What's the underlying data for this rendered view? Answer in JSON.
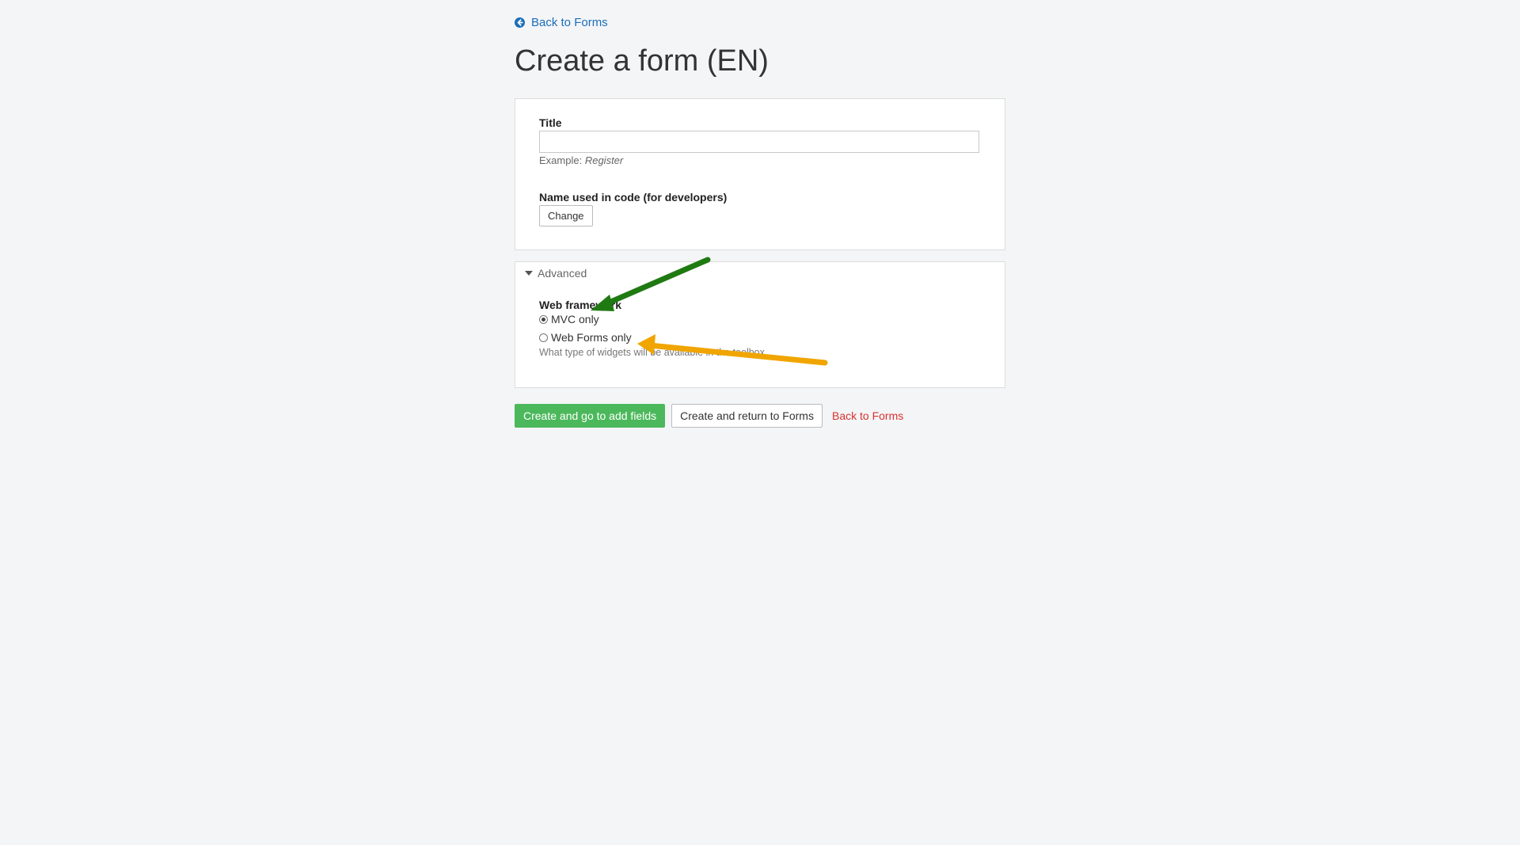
{
  "nav": {
    "back_label": "Back to Forms"
  },
  "page": {
    "title": "Create a form (EN)"
  },
  "form": {
    "title_label": "Title",
    "title_value": "",
    "example_prefix": "Example:",
    "example_value": "Register",
    "code_name_label": "Name used in code (for developers)",
    "change_button": "Change"
  },
  "advanced": {
    "toggle_label": "Advanced",
    "framework_label": "Web framework",
    "options": [
      {
        "label": "MVC only",
        "checked": true
      },
      {
        "label": "Web Forms only",
        "checked": false
      }
    ],
    "help_text": "What type of widgets will be available in the toolbox"
  },
  "actions": {
    "create_add_fields": "Create and go to add fields",
    "create_return": "Create and return to Forms",
    "back_to_forms": "Back to Forms"
  },
  "colors": {
    "link": "#1a6fb9",
    "primary": "#4cb85c",
    "danger": "#d9322e",
    "annotation_green": "#1f7a12",
    "annotation_orange": "#f0a500"
  }
}
